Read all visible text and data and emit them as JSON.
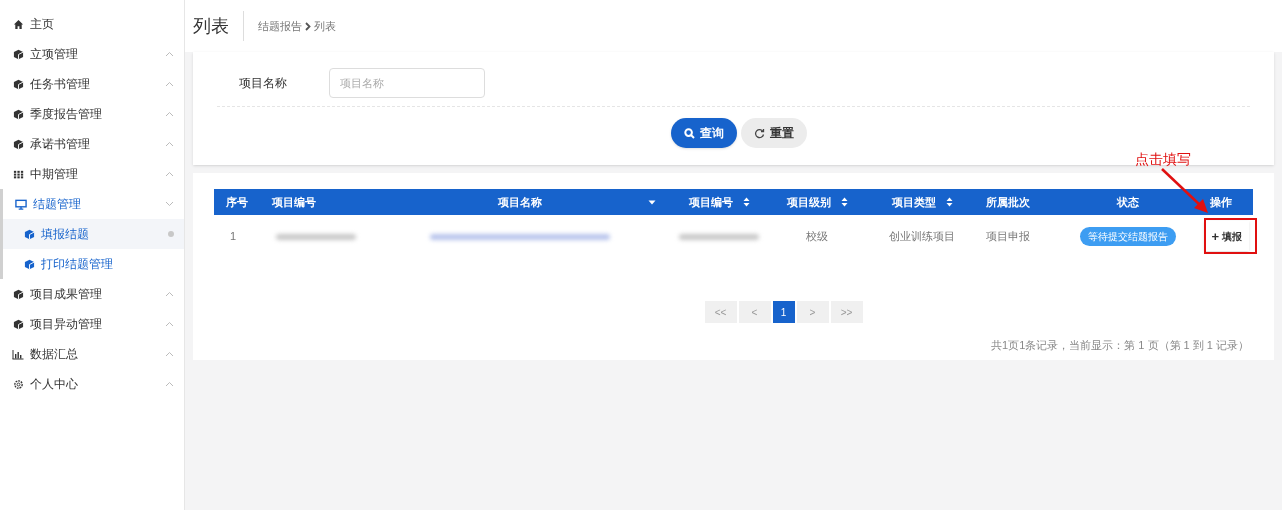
{
  "sidebar": {
    "items": [
      {
        "label": "主页",
        "kind": "home"
      },
      {
        "label": "立项管理",
        "kind": "cube",
        "expanded": false
      },
      {
        "label": "任务书管理",
        "kind": "cube",
        "expanded": false
      },
      {
        "label": "季度报告管理",
        "kind": "cube",
        "expanded": false
      },
      {
        "label": "承诺书管理",
        "kind": "cube",
        "expanded": false
      },
      {
        "label": "中期管理",
        "kind": "grid",
        "expanded": false
      },
      {
        "label": "结题管理",
        "kind": "monitor",
        "expanded": true,
        "selected": true,
        "children": [
          {
            "label": "填报结题",
            "kind": "cube",
            "selected": true
          },
          {
            "label": "打印结题管理",
            "kind": "cube",
            "selected": false
          }
        ]
      },
      {
        "label": "项目成果管理",
        "kind": "cube",
        "expanded": false
      },
      {
        "label": "项目异动管理",
        "kind": "cube",
        "expanded": false
      },
      {
        "label": "数据汇总",
        "kind": "chart",
        "expanded": false
      },
      {
        "label": "个人中心",
        "kind": "gear",
        "expanded": false
      }
    ]
  },
  "header": {
    "title": "列表",
    "breadcrumb": [
      "结题报告",
      "列表"
    ]
  },
  "search": {
    "label": "项目名称",
    "placeholder": "项目名称",
    "buttons": [
      {
        "label": "查询",
        "kind": "primary"
      },
      {
        "label": "重置",
        "kind": "reset"
      }
    ]
  },
  "table": {
    "columns": [
      {
        "label": "序号"
      },
      {
        "label": "项目编号"
      },
      {
        "label": "项目名称",
        "sorted_desc": true
      },
      {
        "label": "项目编号",
        "sortable": true
      },
      {
        "label": "项目级别",
        "sortable": true
      },
      {
        "label": "项目类型",
        "sortable": true
      },
      {
        "label": "所属批次"
      },
      {
        "label": "状态"
      },
      {
        "label": "操作"
      }
    ],
    "rows": [
      {
        "cells": [
          {
            "kind": "text",
            "text": "1"
          },
          {
            "kind": "redacted"
          },
          {
            "kind": "redacted_link"
          },
          {
            "kind": "redacted"
          },
          {
            "kind": "text",
            "text": "校级"
          },
          {
            "kind": "text",
            "text": "创业训练项目"
          },
          {
            "kind": "text",
            "text": "项目申报"
          },
          {
            "kind": "badge",
            "text": "等待提交结题报告"
          },
          {
            "kind": "action",
            "text": "填报",
            "icon": "+"
          }
        ]
      }
    ]
  },
  "pagination": {
    "pages": [
      {
        "label": "<<",
        "kind": "nav"
      },
      {
        "label": "<",
        "kind": "nav"
      },
      {
        "label": "1",
        "kind": "page",
        "selected": true
      },
      {
        "label": ">",
        "kind": "nav"
      },
      {
        "label": ">>",
        "kind": "nav"
      }
    ],
    "summary": "共1页1条记录，当前显示：第 1 页（第 1 到 1 记录）"
  },
  "annotation": {
    "text": "点击填写"
  }
}
